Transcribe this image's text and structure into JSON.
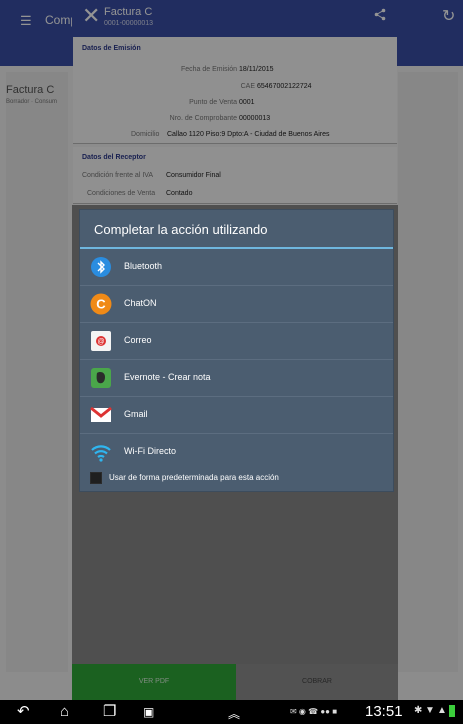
{
  "background_app": {
    "title": "Comp",
    "left_card_title": "Factura C",
    "left_card_subtitle": "Borrador · Consum"
  },
  "invoice": {
    "title": "Factura C",
    "number": "0001-00000013",
    "emision": {
      "heading": "Datos de Emisión",
      "rows": [
        {
          "label": "Fecha de Emisión",
          "value": "18/11/2015"
        },
        {
          "label": "CAE",
          "value": "65467002122724"
        },
        {
          "label": "Punto de Venta",
          "value": "0001"
        },
        {
          "label": "Nro. de Comprobante",
          "value": "00000013"
        },
        {
          "label": "Domicilio",
          "value": "Callao 1120 Piso:9 Dpto:A - Ciudad de Buenos Aires"
        }
      ]
    },
    "receptor": {
      "heading": "Datos del Receptor",
      "rows": [
        {
          "label": "Condición frente al IVA",
          "value": "Consumidor Final"
        },
        {
          "label": "Condiciones de Venta",
          "value": "Contado"
        }
      ]
    },
    "buttons": {
      "pdf": "VER PDF",
      "cobrar": "COBRAR"
    }
  },
  "chooser": {
    "title": "Completar la acción utilizando",
    "items": [
      {
        "label": "Bluetooth",
        "icon": "bluetooth-icon"
      },
      {
        "label": "ChatON",
        "icon": "chaton-icon"
      },
      {
        "label": "Correo",
        "icon": "email-icon"
      },
      {
        "label": "Evernote - Crear nota",
        "icon": "evernote-icon"
      },
      {
        "label": "Gmail",
        "icon": "gmail-icon"
      },
      {
        "label": "Wi-Fi Directo",
        "icon": "wifi-direct-icon"
      }
    ],
    "default_label": "Usar de forma predeterminada para esta acción"
  },
  "status": {
    "time": "13:51"
  },
  "colors": {
    "appbar": "#3a4fa6",
    "accent_green": "#2fa838",
    "dialog": "#4b5d70",
    "divider": "#6fb6de"
  }
}
